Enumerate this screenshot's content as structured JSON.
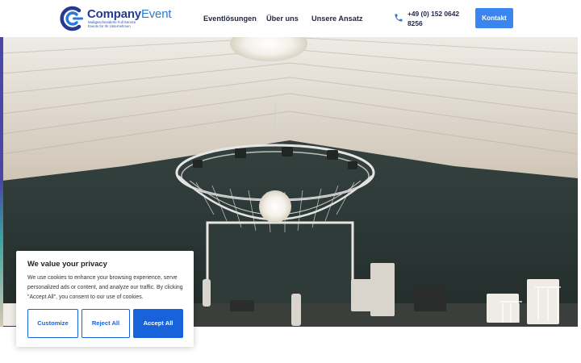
{
  "header": {
    "logo": {
      "name_part1": "Company",
      "name_part2": "Event",
      "tagline_line1": "Maßgeschneiderte Full Service",
      "tagline_line2": "Events für Ihr Unternehmen"
    },
    "nav": [
      {
        "label": "Eventlösungen"
      },
      {
        "label": "Über uns"
      },
      {
        "label": "Unsere Ansatz"
      }
    ],
    "phone": {
      "icon": "phone-icon",
      "number": "+49 (0) 152 0642 8256"
    },
    "contact_button": "Kontakt"
  },
  "hero": {
    "image": "event-hall-chandelier-photo"
  },
  "cookie_banner": {
    "title": "We value your privacy",
    "text": "We use cookies to enhance your browsing experience, serve personalized ads or content, and analyze our traffic. By clicking \"Accept All\", you consent to our use of cookies.",
    "buttons": {
      "customize": "Customize",
      "reject": "Reject All",
      "accept": "Accept All"
    }
  },
  "colors": {
    "brand_dark": "#243b8f",
    "brand_light": "#2a7bd6",
    "contact_button": "#3a86ee",
    "cookie_accent": "#1863dc"
  }
}
